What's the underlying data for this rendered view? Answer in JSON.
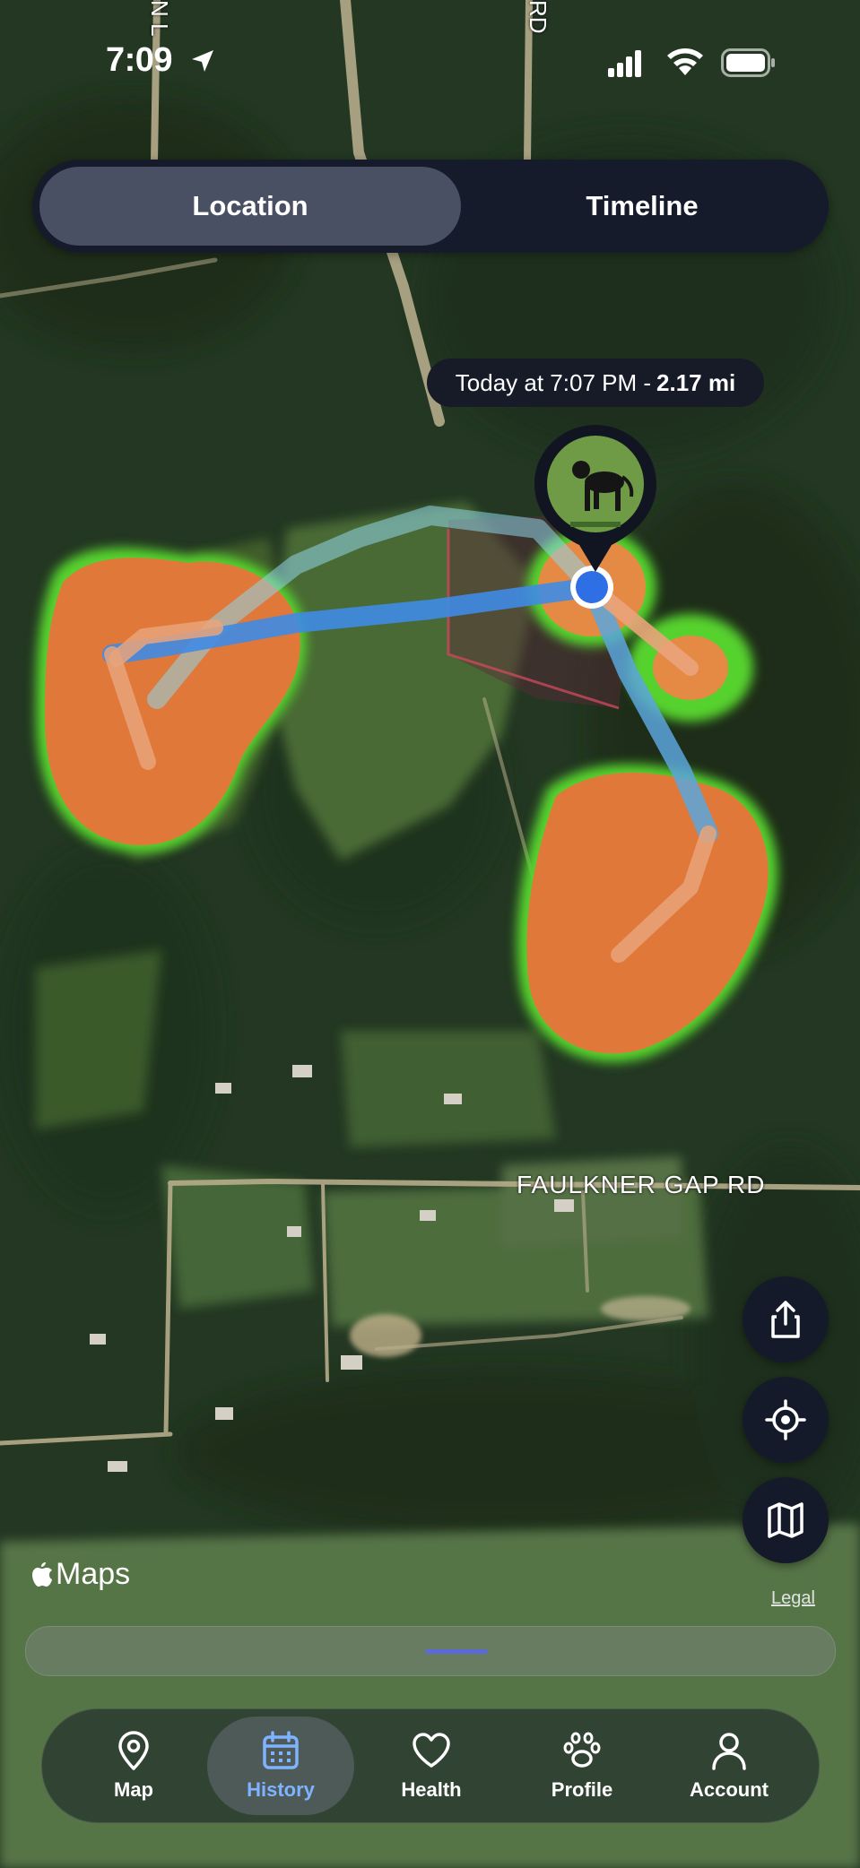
{
  "status_bar": {
    "time": "7:09"
  },
  "segmented": {
    "left_label": "Location",
    "right_label": "Timeline",
    "selected": "Location"
  },
  "tooltip": {
    "prefix": "Today at 7:07 PM -",
    "distance": "2.17 mi"
  },
  "map": {
    "road_label": "FAULKNER GAP RD",
    "top_road_label_1": "N L",
    "top_road_label_2": "RD",
    "attribution": "Maps",
    "legal": "Legal"
  },
  "fabs": [
    {
      "name": "share-button",
      "icon": "share-icon"
    },
    {
      "name": "recenter-button",
      "icon": "crosshair-icon"
    },
    {
      "name": "map-style-button",
      "icon": "map-icon"
    }
  ],
  "tabbar": {
    "selected": "History",
    "items": [
      {
        "label": "Map",
        "icon": "map-pin-icon"
      },
      {
        "label": "History",
        "icon": "calendar-icon"
      },
      {
        "label": "Health",
        "icon": "heart-icon"
      },
      {
        "label": "Profile",
        "icon": "paw-icon"
      },
      {
        "label": "Account",
        "icon": "person-icon"
      }
    ]
  },
  "colors": {
    "accent": "#7fb3ff",
    "heat_orange": "#e0783a",
    "path_blue": "#3f8be6",
    "location_dot": "#2f6fe6",
    "control_bg": "#161b2b"
  }
}
